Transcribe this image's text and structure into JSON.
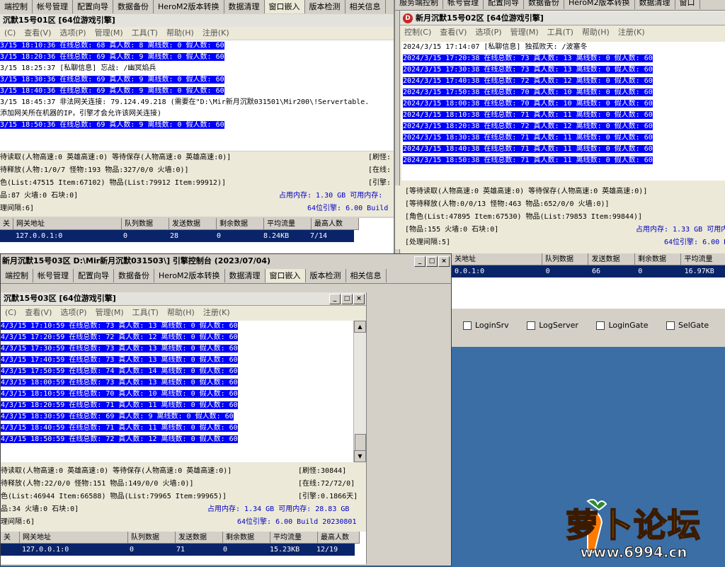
{
  "win1": {
    "tabs": [
      "端控制",
      "帐号管理",
      "配置向导",
      "数据备份",
      "HeroM2版本转换",
      "数据清理",
      "窗口嵌入",
      "版本检测",
      "相关信息"
    ],
    "title": "沉默15号01区 [64位游戏引擎]",
    "menu": [
      "(C)",
      "查看(V)",
      "选项(P)",
      "管理(M)",
      "工具(T)",
      "帮助(H)",
      "注册(K)"
    ],
    "log": [
      {
        "text": "3/15 18:10:36 在线总数: 68 真人数: 8 离线数: 0 假人数: 60",
        "hl": true
      },
      {
        "text": "3/15 18:20:36 在线总数: 69 真人数: 9 离线数: 0 假人数: 60",
        "hl": true
      },
      {
        "text": "3/15 18:25:37 [私聊信息] 忘战: /幽冥焰兵",
        "hl": false
      },
      {
        "text": "3/15 18:30:36 在线总数: 69 真人数: 9 离线数: 0 假人数: 60",
        "hl": true
      },
      {
        "text": "3/15 18:40:36 在线总数: 69 真人数: 9 离线数: 0 假人数: 60",
        "hl": true
      },
      {
        "text": "3/15 18:45:37 非法网关连接: 79.124.49.218 (需要在\"D:\\Mir新月沉默031501\\Mir200\\!Servertable.",
        "hl": false
      },
      {
        "text": "添加网关所在机器的IP，引擎才会允许该网关连接)",
        "hl": false
      },
      {
        "text": "3/15 18:50:36 在线总数: 69 真人数: 9 离线数: 0 假人数: 60",
        "hl": true
      }
    ],
    "status": [
      "待读取(人物高速:0 英雄高速:0) 等待保存(人物高速:0 英雄高速:0)]",
      "待释放(人物:1/0/7 怪物:193 物品:327/0/0 火墙:0)]",
      "色(List:47515 Item:67102) 物品(List:79912 Item:99912)]",
      "品:87 火墙:0 石块:0]",
      "理间隔:6]"
    ],
    "status_right": [
      "[刷怪:",
      "[在线:",
      "[引擎:",
      "占用内存: 1.30 GB 可用内存:",
      "64位引擎: 6.00 Build"
    ],
    "gw_head": [
      "关",
      "网关地址",
      "队列数据",
      "发送数据",
      "剩余数据",
      "平均流量",
      "最高人数"
    ],
    "gw_row": [
      "",
      "127.0.0.1:0",
      "0",
      "28",
      "0",
      "8.24KB",
      "7/14"
    ]
  },
  "win2": {
    "tabs": [
      "服务端控制",
      "帐号管理",
      "配置向导",
      "数据备份",
      "HeroM2版本转换",
      "数据清理",
      "窗口"
    ],
    "title": "新月沉默15号02区 [64位游戏引擎]",
    "menu": [
      "控制(C)",
      "查看(V)",
      "选项(P)",
      "管理(M)",
      "工具(T)",
      "帮助(H)",
      "注册(K)"
    ],
    "log": [
      {
        "text": "2024/3/15 17:14:07 [私聊信息] 独孤败天: /波塞冬",
        "hl": false
      },
      {
        "text": "2024/3/15 17:20:38 在线总数: 73 真人数: 13 离线数: 0 假人数: 60",
        "hl": true
      },
      {
        "text": "2024/3/15 17:30:38 在线总数: 73 真人数: 13 离线数: 0 假人数: 60",
        "hl": true
      },
      {
        "text": "2024/3/15 17:40:38 在线总数: 72 真人数: 12 离线数: 0 假人数: 60",
        "hl": true
      },
      {
        "text": "2024/3/15 17:50:38 在线总数: 70 真人数: 10 离线数: 0 假人数: 60",
        "hl": true
      },
      {
        "text": "2024/3/15 18:00:38 在线总数: 70 真人数: 10 离线数: 0 假人数: 60",
        "hl": true
      },
      {
        "text": "2024/3/15 18:10:38 在线总数: 71 真人数: 11 离线数: 0 假人数: 60",
        "hl": true
      },
      {
        "text": "2024/3/15 18:20:38 在线总数: 72 真人数: 12 离线数: 0 假人数: 60",
        "hl": true
      },
      {
        "text": "2024/3/15 18:30:38 在线总数: 71 真人数: 11 离线数: 0 假人数: 60",
        "hl": true
      },
      {
        "text": "2024/3/15 18:40:38 在线总数: 71 真人数: 11 离线数: 0 假人数: 60",
        "hl": true
      },
      {
        "text": "2024/3/15 18:50:38 在线总数: 71 真人数: 11 离线数: 0 假人数: 60",
        "hl": true
      }
    ],
    "status": [
      "[等待读取(人物高速:0 英雄高速:0) 等待保存(人物高速:0 英雄高速:0)]",
      "[等待释放(人物:0/0/13 怪物:463 物品:652/0/0 火墙:0)]",
      "[角色(List:47895 Item:67530) 物品(List:79853 Item:99844)]",
      "[物品:155 火墙:0 石块:0]",
      "[处理间隔:5]"
    ],
    "status_right": [
      "[刷",
      "[在",
      "[引",
      "占用内存: 1.33 GB 可用内",
      "64位引擎: 6.00 Build"
    ],
    "gw_head": [
      "关地址",
      "队列数据",
      "发送数据",
      "剩余数据",
      "平均流量"
    ],
    "gw_row": [
      "0.0.1:0",
      "0",
      "66",
      "0",
      "16.97KB"
    ],
    "checks": [
      "LoginSrv",
      "LogServer",
      "LoginGate",
      "SelGate"
    ]
  },
  "win3": {
    "outer_title": "新月沉默15号03区 D:\\Mir新月沉默031503\\] 引擎控制台 (2023/07/04)",
    "tabs": [
      "端控制",
      "帐号管理",
      "配置向导",
      "数据备份",
      "HeroM2版本转换",
      "数据清理",
      "窗口嵌入",
      "版本检测",
      "相关信息"
    ],
    "title": "沉默15号03区 [64位游戏引擎]",
    "menu": [
      "(C)",
      "查看(V)",
      "选项(P)",
      "管理(M)",
      "工具(T)",
      "帮助(H)",
      "注册(K)"
    ],
    "log": [
      {
        "text": "4/3/15 17:10:59 在线总数: 73 真人数: 13 离线数: 0 假人数: 60",
        "hl": true
      },
      {
        "text": "4/3/15 17:20:59 在线总数: 72 真人数: 12 离线数: 0 假人数: 60",
        "hl": true
      },
      {
        "text": "4/3/15 17:30:59 在线总数: 73 真人数: 13 离线数: 0 假人数: 60",
        "hl": true
      },
      {
        "text": "4/3/15 17:40:59 在线总数: 73 真人数: 13 离线数: 0 假人数: 60",
        "hl": true
      },
      {
        "text": "4/3/15 17:50:59 在线总数: 74 真人数: 14 离线数: 0 假人数: 60",
        "hl": true
      },
      {
        "text": "4/3/15 18:00:59 在线总数: 73 真人数: 13 离线数: 0 假人数: 60",
        "hl": true
      },
      {
        "text": "4/3/15 18:10:59 在线总数: 70 真人数: 10 离线数: 0 假人数: 60",
        "hl": true
      },
      {
        "text": "4/3/15 18:20:59 在线总数: 71 真人数: 11 离线数: 0 假人数: 60",
        "hl": true
      },
      {
        "text": "4/3/15 18:30:59 在线总数: 69 真人数: 9 离线数: 0 假人数: 60",
        "hl": true
      },
      {
        "text": "4/3/15 18:40:59 在线总数: 71 真人数: 11 离线数: 0 假人数: 60",
        "hl": true
      },
      {
        "text": "4/3/15 18:50:59 在线总数: 72 真人数: 12 离线数: 0 假人数: 60",
        "hl": true
      }
    ],
    "status": [
      "待读取(人物高速:0 英雄高速:0) 等待保存(人物高速:0 英雄高速:0)]",
      "待释放(人物:22/0/0 怪物:151 物品:149/0/0 火墙:0)]",
      "色(List:46944 Item:66588) 物品(List:79965 Item:99965)]",
      "品:34 火墙:0 石块:0]",
      "理间隔:6]"
    ],
    "status_right": [
      "[刷怪:30844]",
      "[在线:72/72/0]",
      "[引擎:0.1866天]",
      "占用内存: 1.34 GB 可用内存: 28.83 GB",
      "64位引擎: 6.00 Build 20230801"
    ],
    "gw_head": [
      "关",
      "网关地址",
      "队列数据",
      "发送数据",
      "剩余数据",
      "平均流量",
      "最高人数"
    ],
    "gw_row": [
      "",
      "127.0.0.1:0",
      "0",
      "71",
      "0",
      "15.23KB",
      "12/19"
    ]
  },
  "watermark": {
    "brand": "萝卜论坛",
    "url": "www.6994.cn"
  }
}
